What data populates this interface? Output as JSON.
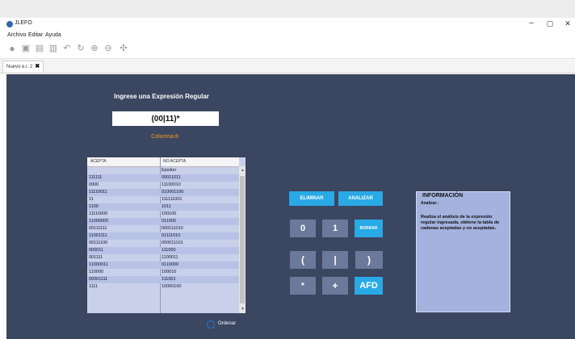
{
  "window": {
    "title": "JLEFO",
    "min": "–",
    "max": "▢",
    "close": "✕"
  },
  "menu": [
    "Archivo",
    "Editar",
    "Ayuda"
  ],
  "tab": {
    "label": "Nuevo e.r. 2",
    "close": "✖"
  },
  "main": {
    "prompt": "Ingrese una Expresión Regular",
    "regex": "(00|11)*",
    "column": "Columna:8"
  },
  "table": {
    "headers": [
      "ACEPTA",
      "NO ACEPTA"
    ],
    "rows": [
      [
        "",
        "Epsilon"
      ],
      [
        "111111",
        "00011011"
      ],
      [
        "0000",
        "11100010"
      ],
      [
        "11110011",
        "010001100"
      ],
      [
        "11",
        "111111001"
      ],
      [
        "1100",
        "1011"
      ],
      [
        "11110000",
        "100100"
      ],
      [
        "11000000",
        "011000"
      ],
      [
        "00111111",
        "000111010"
      ],
      [
        "11001111",
        "01111010"
      ],
      [
        "00111100",
        "000011101"
      ],
      [
        "000011",
        "111000"
      ],
      [
        "001111",
        "1100011"
      ],
      [
        "11000011",
        "0110000"
      ],
      [
        "110000",
        "100010"
      ],
      [
        "00001111",
        "111001"
      ],
      [
        "1111",
        "10000100"
      ]
    ],
    "scroll_up": "▲",
    "scroll_down": "▼"
  },
  "sort": {
    "label": "Ordenar"
  },
  "buttons": {
    "eliminar": "ELIMINAR",
    "analizar": "ANALIZAR",
    "zero": "0",
    "one": "1",
    "borrar": "BORRAR",
    "lparen": "(",
    "pipe": "|",
    "rparen": ")",
    "star": "*",
    "plus": "+",
    "afd": "AFD"
  },
  "info": {
    "title": "INFORMACIÓN",
    "subtitle": "Analizar :",
    "body": "Realiza el análisis de la expresión regular ingresada, obtiene la tabla de cadenas aceptadas y no aceptadas."
  },
  "colors": {
    "workspace": "#3b4660",
    "button_primary": "#29a9e6",
    "button_dark": "#6b7a9a",
    "info_panel": "#a4b2de",
    "column_text": "#f0a020"
  }
}
